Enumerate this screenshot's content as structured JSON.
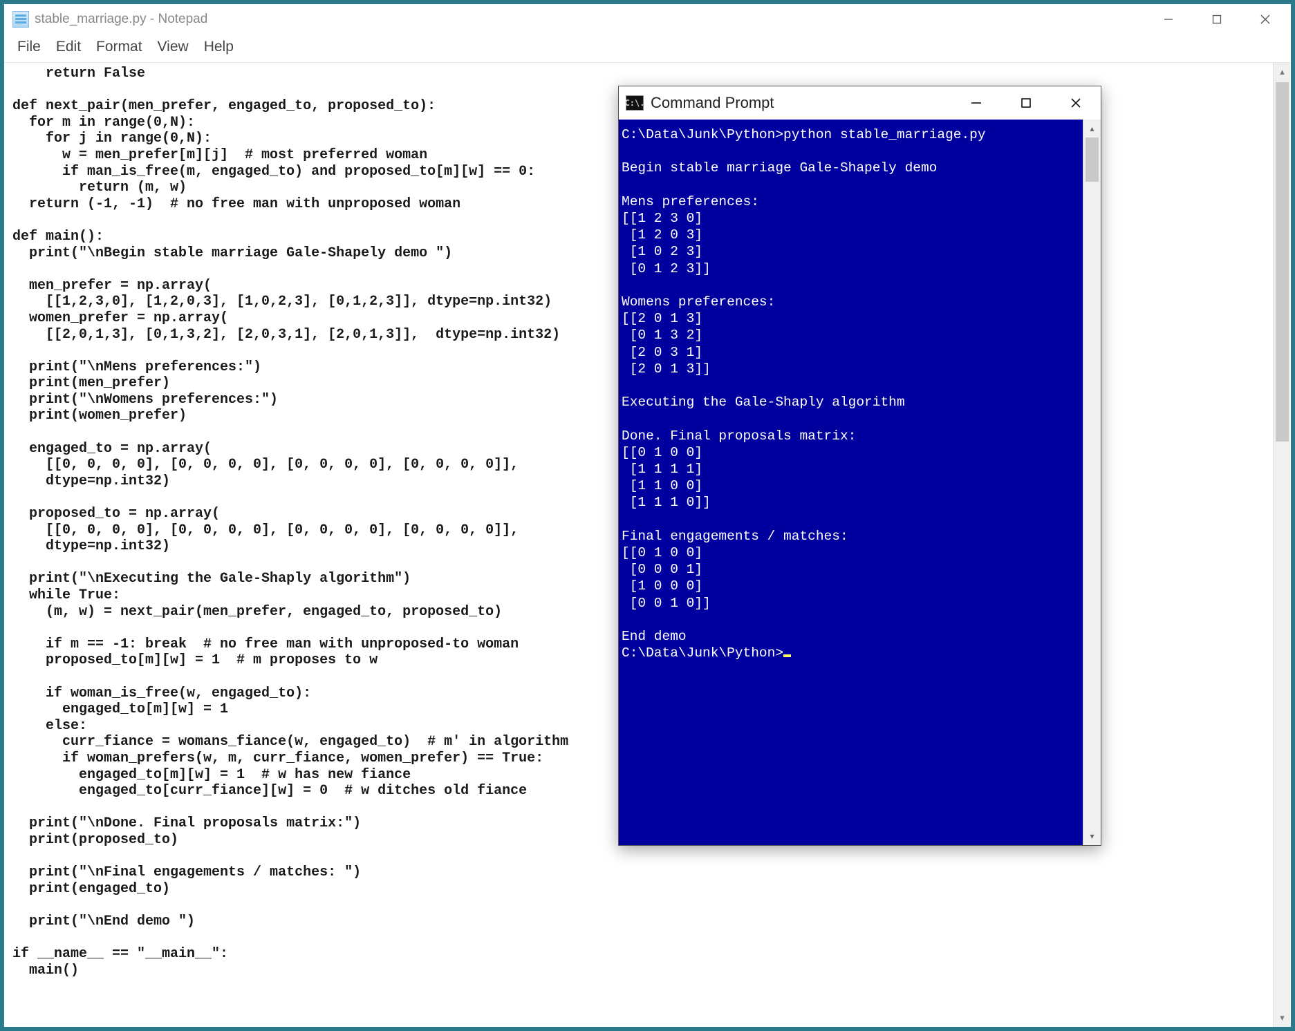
{
  "notepad": {
    "title": "stable_marriage.py - Notepad",
    "menubar": [
      "File",
      "Edit",
      "Format",
      "View",
      "Help"
    ],
    "content": "    return False\n\ndef next_pair(men_prefer, engaged_to, proposed_to):\n  for m in range(0,N):\n    for j in range(0,N):\n      w = men_prefer[m][j]  # most preferred woman\n      if man_is_free(m, engaged_to) and proposed_to[m][w] == 0:\n        return (m, w)\n  return (-1, -1)  # no free man with unproposed woman\n\ndef main():\n  print(\"\\nBegin stable marriage Gale-Shapely demo \")\n\n  men_prefer = np.array(\n    [[1,2,3,0], [1,2,0,3], [1,0,2,3], [0,1,2,3]], dtype=np.int32)\n  women_prefer = np.array(\n    [[2,0,1,3], [0,1,3,2], [2,0,3,1], [2,0,1,3]],  dtype=np.int32)\n\n  print(\"\\nMens preferences:\")\n  print(men_prefer)\n  print(\"\\nWomens preferences:\")\n  print(women_prefer)\n\n  engaged_to = np.array(\n    [[0, 0, 0, 0], [0, 0, 0, 0], [0, 0, 0, 0], [0, 0, 0, 0]],\n    dtype=np.int32)\n\n  proposed_to = np.array(\n    [[0, 0, 0, 0], [0, 0, 0, 0], [0, 0, 0, 0], [0, 0, 0, 0]],\n    dtype=np.int32)\n\n  print(\"\\nExecuting the Gale-Shaply algorithm\")\n  while True:\n    (m, w) = next_pair(men_prefer, engaged_to, proposed_to)\n\n    if m == -1: break  # no free man with unproposed-to woman\n    proposed_to[m][w] = 1  # m proposes to w\n\n    if woman_is_free(w, engaged_to):\n      engaged_to[m][w] = 1\n    else:\n      curr_fiance = womans_fiance(w, engaged_to)  # m' in algorithm\n      if woman_prefers(w, m, curr_fiance, women_prefer) == True:\n        engaged_to[m][w] = 1  # w has new fiance\n        engaged_to[curr_fiance][w] = 0  # w ditches old fiance\n\n  print(\"\\nDone. Final proposals matrix:\")\n  print(proposed_to)\n\n  print(\"\\nFinal engagements / matches: \")\n  print(engaged_to)\n\n  print(\"\\nEnd demo \")\n\nif __name__ == \"__main__\":\n  main()"
  },
  "cmd": {
    "title": "Command Prompt",
    "icon_label": "C:\\.",
    "prompt_path": "C:\\Data\\Junk\\Python>",
    "output": "C:\\Data\\Junk\\Python>python stable_marriage.py\n\nBegin stable marriage Gale-Shapely demo\n\nMens preferences:\n[[1 2 3 0]\n [1 2 0 3]\n [1 0 2 3]\n [0 1 2 3]]\n\nWomens preferences:\n[[2 0 1 3]\n [0 1 3 2]\n [2 0 3 1]\n [2 0 1 3]]\n\nExecuting the Gale-Shaply algorithm\n\nDone. Final proposals matrix:\n[[0 1 0 0]\n [1 1 1 1]\n [1 1 0 0]\n [1 1 1 0]]\n\nFinal engagements / matches:\n[[0 1 0 0]\n [0 0 0 1]\n [1 0 0 0]\n [0 0 1 0]]\n\nEnd demo\n"
  }
}
